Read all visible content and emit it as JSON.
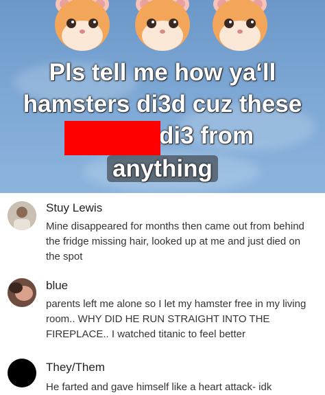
{
  "post": {
    "caption_lines": [
      "Pls tell me how ya‘ll",
      "hamsters di3d cuz these",
      "di3 from",
      "anything"
    ],
    "censor_color": "#ff0000",
    "header_icons": [
      "hamster-face-icon",
      "hamster-face-icon",
      "hamster-face-icon"
    ]
  },
  "comments": [
    {
      "name": "Stuy Lewis",
      "text": "Mine disappeared for months then came out from behind the fridge missing hair, looked up at me and just died on the spot"
    },
    {
      "name": "blue",
      "text": "parents left me alone so I let my hamster free in my living room.. WHY DID HE RUN STRAIGHT INTO THE FIREPLACE.. I watched titanic to feel better"
    },
    {
      "name": "They/Them",
      "text": "He farted and gave himself like a heart attack- idk"
    }
  ]
}
